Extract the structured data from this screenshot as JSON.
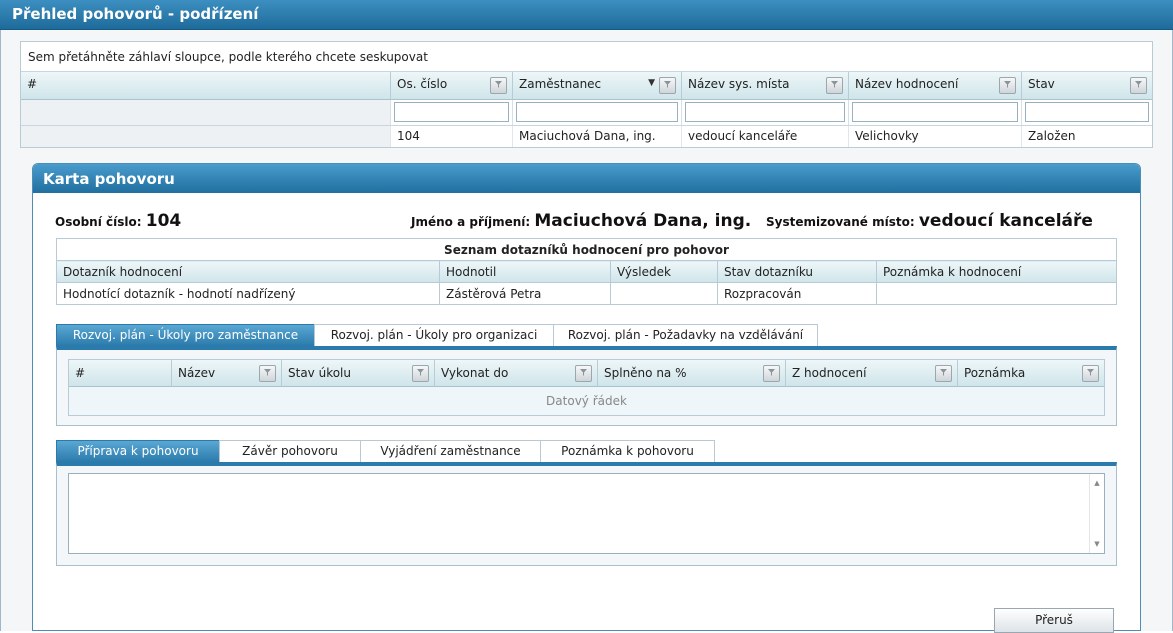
{
  "window": {
    "title": "Přehled pohovorů - podřízení"
  },
  "grid": {
    "group_hint": "Sem přetáhněte záhlaví sloupce, podle kterého chcete seskupovat",
    "columns": [
      "#",
      "Os. číslo",
      "Zaměstnanec",
      "Název sys. místa",
      "Název hodnocení",
      "Stav"
    ],
    "rows": [
      {
        "hash": "",
        "os_cislo": "104",
        "zamestnanec": "Maciuchová Dana, ing.",
        "misto": "vedoucí kanceláře",
        "hodnoceni": "Velichovky",
        "stav": "Založen"
      }
    ]
  },
  "card": {
    "title": "Karta pohovoru",
    "osobni_cislo_label": "Osobní číslo:",
    "osobni_cislo_value": "104",
    "jmeno_label": "Jméno a příjmení:",
    "jmeno_value": "Maciuchová Dana, ing.",
    "misto_label": "Systemizované místo:",
    "misto_value": "vedoucí kanceláře",
    "dotazniky": {
      "title": "Seznam dotazníků hodnocení pro pohovor",
      "columns": [
        "Dotazník hodnocení",
        "Hodnotil",
        "Výsledek",
        "Stav dotazníku",
        "Poznámka k hodnocení"
      ],
      "rows": [
        {
          "dotaznik": "Hodnotící dotazník - hodnotí nadřízený",
          "hodnotil": "Zástěrová Petra",
          "vysledek": "",
          "stav": "Rozpracován",
          "poznamka": ""
        }
      ]
    },
    "plan_tabs": [
      "Rozvoj. plán - Úkoly pro zaměstnance",
      "Rozvoj. plán - Úkoly pro organizaci",
      "Rozvoj. plán - Požadavky na vzdělávání"
    ],
    "plan_columns": [
      "#",
      "Název",
      "Stav úkolu",
      "Vykonat do",
      "Splněno na %",
      "Z hodnocení",
      "Poznámka"
    ],
    "plan_empty": "Datový řádek",
    "notes_tabs": [
      "Příprava k pohovoru",
      "Závěr pohovoru",
      "Vyjádření zaměstnance",
      "Poznámka k pohovoru"
    ],
    "notes_value": "",
    "cancel_label": "Přeruš"
  },
  "colors": {
    "header_blue": "#2a7aab",
    "active_tab": "#3b8cbf"
  },
  "icons": {
    "filter": "filter-icon",
    "sort": "sort-desc-icon"
  }
}
